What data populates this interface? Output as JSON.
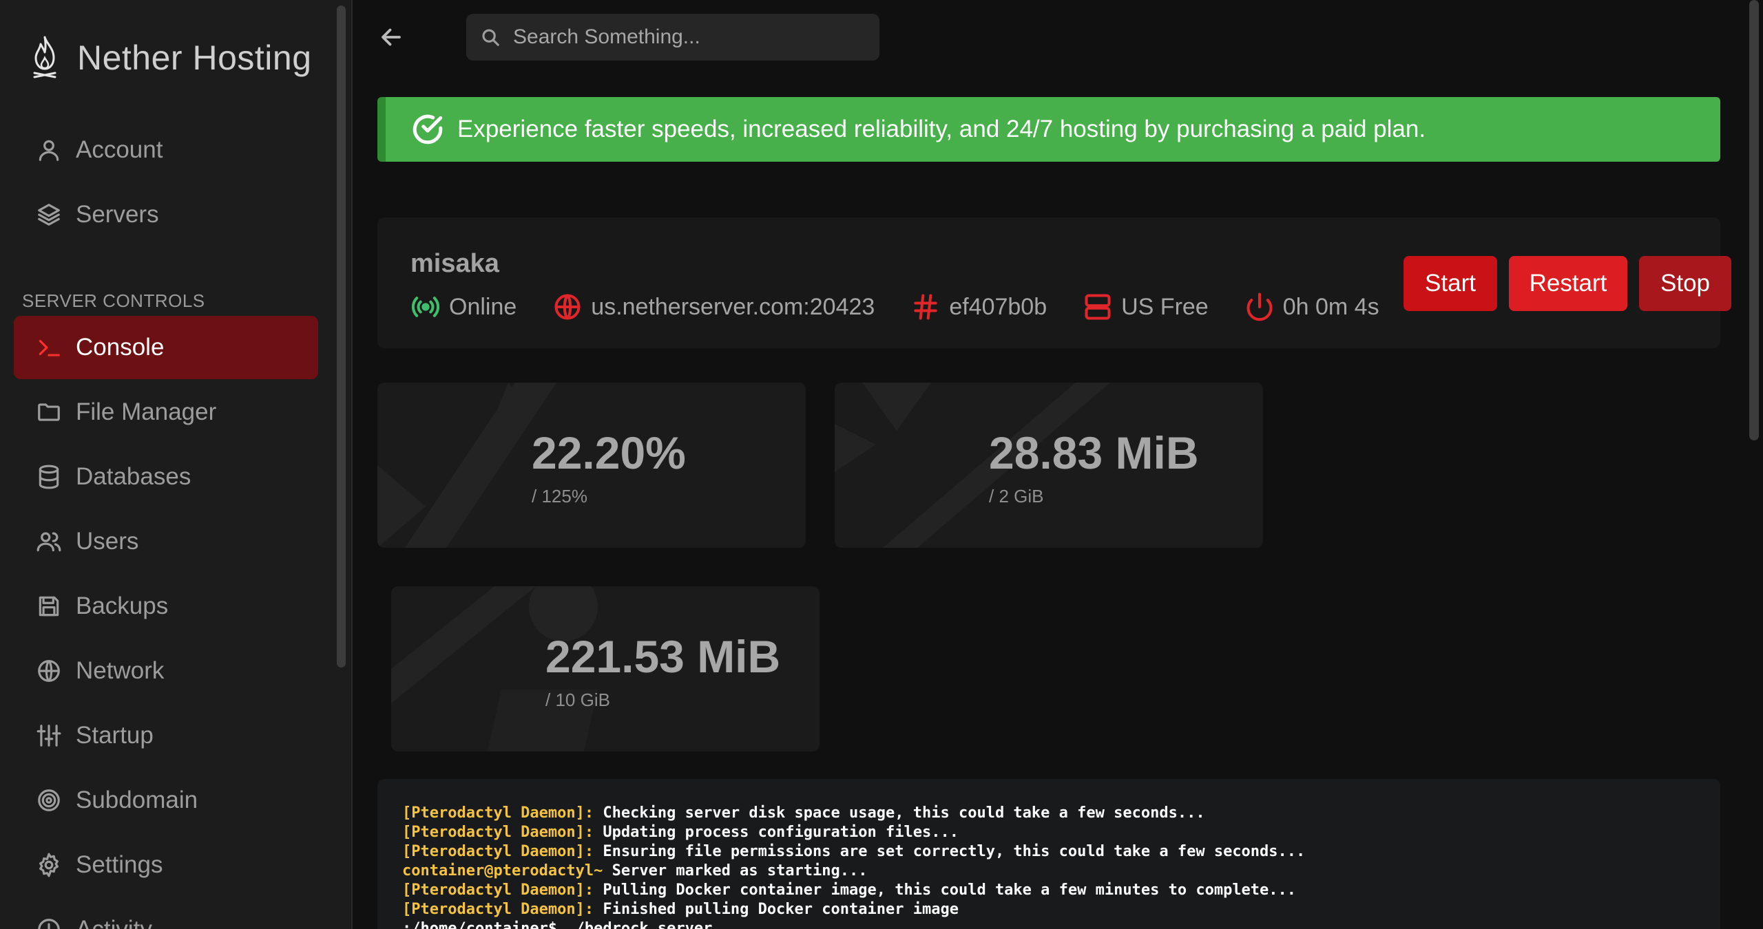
{
  "brand": {
    "name": "Nether Hosting"
  },
  "sidebar": {
    "top_items": [
      {
        "label": "Account",
        "icon": "user-icon"
      },
      {
        "label": "Servers",
        "icon": "layers-icon"
      }
    ],
    "section_label": "SERVER CONTROLS",
    "items": [
      {
        "label": "Console",
        "icon": "terminal-icon",
        "active": true
      },
      {
        "label": "File Manager",
        "icon": "folder-icon"
      },
      {
        "label": "Databases",
        "icon": "database-icon"
      },
      {
        "label": "Users",
        "icon": "users-icon"
      },
      {
        "label": "Backups",
        "icon": "save-icon"
      },
      {
        "label": "Network",
        "icon": "globe-icon"
      },
      {
        "label": "Startup",
        "icon": "sliders-icon"
      },
      {
        "label": "Subdomain",
        "icon": "target-icon"
      },
      {
        "label": "Settings",
        "icon": "gear-icon"
      },
      {
        "label": "Activity",
        "icon": "activity-icon"
      }
    ]
  },
  "search": {
    "placeholder": "Search Something..."
  },
  "banner": {
    "text": "Experience faster speeds, increased reliability, and 24/7 hosting by purchasing a paid plan.",
    "color": "#47b04b"
  },
  "server": {
    "name": "misaka",
    "status": "Online",
    "address": "us.netherserver.com:20423",
    "id": "ef407b0b",
    "node": "US Free",
    "uptime": "0h 0m 4s",
    "buttons": {
      "start": "Start",
      "restart": "Restart",
      "stop": "Stop"
    }
  },
  "stats": {
    "cpu": {
      "value": "22.20%",
      "limit": "/ 125%"
    },
    "memory": {
      "value": "28.83 MiB",
      "limit": "/ 2 GiB"
    },
    "disk": {
      "value": "221.53 MiB",
      "limit": "/ 10 GiB"
    }
  },
  "console": {
    "lines": [
      {
        "prefix": "[Pterodactyl Daemon]:",
        "text": " Checking server disk space usage, this could take a few seconds..."
      },
      {
        "prefix": "[Pterodactyl Daemon]:",
        "text": " Updating process configuration files..."
      },
      {
        "prefix": "[Pterodactyl Daemon]:",
        "text": " Ensuring file permissions are set correctly, this could take a few seconds..."
      },
      {
        "prefix": "container@pterodactyl~",
        "text": " Server marked as starting..."
      },
      {
        "prefix": "[Pterodactyl Daemon]:",
        "text": " Pulling Docker container image, this could take a few minutes to complete..."
      },
      {
        "prefix": "[Pterodactyl Daemon]:",
        "text": " Finished pulling Docker container image"
      },
      {
        "prefix": "",
        "text": ":/home/container$ ./bedrock_server"
      }
    ]
  },
  "colors": {
    "accent": "#dc1e22",
    "active_nav": "#6d1014",
    "online": "#3fbf6b"
  }
}
